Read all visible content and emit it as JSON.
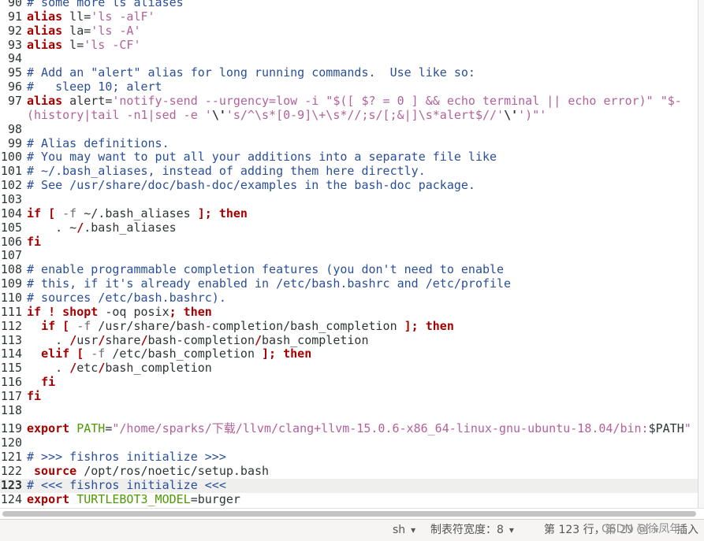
{
  "editor": {
    "lines": [
      {
        "n": "90",
        "segments": [
          {
            "t": "# some more ls aliases",
            "c": "#2a4f9a"
          }
        ]
      },
      {
        "n": "91",
        "segments": [
          {
            "t": "alias",
            "c": "#a40000",
            "b": true
          },
          {
            "t": " ll="
          },
          {
            "t": "'ls -alF'",
            "c": "#b2619a"
          }
        ]
      },
      {
        "n": "92",
        "segments": [
          {
            "t": "alias",
            "c": "#a40000",
            "b": true
          },
          {
            "t": " la="
          },
          {
            "t": "'ls -A'",
            "c": "#b2619a"
          }
        ]
      },
      {
        "n": "93",
        "segments": [
          {
            "t": "alias",
            "c": "#a40000",
            "b": true
          },
          {
            "t": " l="
          },
          {
            "t": "'ls -CF'",
            "c": "#b2619a"
          }
        ]
      },
      {
        "n": "94",
        "segments": []
      },
      {
        "n": "95",
        "segments": [
          {
            "t": "# Add an \"alert\" alias for long running commands.  Use like so:",
            "c": "#2a4f9a"
          }
        ]
      },
      {
        "n": "96",
        "segments": [
          {
            "t": "#   sleep 10; alert",
            "c": "#2a4f9a"
          }
        ]
      },
      {
        "n": "97",
        "segments": [
          {
            "t": "alias",
            "c": "#a40000",
            "b": true
          },
          {
            "t": " alert="
          },
          {
            "t": "'notify-send --urgency=low -i \"$([ $? = 0 ] && echo terminal || echo error)\" \"$-",
            "c": "#b2619a"
          }
        ],
        "continuation": [
          {
            "t": "(history|tail -n1|sed -e '",
            "c": "#b2619a"
          },
          {
            "t": "\\'",
            "c": "#2e3436",
            "b": true
          },
          {
            "t": "'s/^\\s*[0-9]\\+\\s*//;s/[;&|]\\s*alert$//'",
            "c": "#b2619a"
          },
          {
            "t": "\\'",
            "c": "#2e3436",
            "b": true
          },
          {
            "t": "')\"'",
            "c": "#b2619a"
          }
        ]
      },
      {
        "n": "98",
        "segments": []
      },
      {
        "n": "99",
        "segments": [
          {
            "t": "# Alias definitions.",
            "c": "#2a4f9a"
          }
        ]
      },
      {
        "n": "100",
        "segments": [
          {
            "t": "# You may want to put all your additions into a separate file like",
            "c": "#2a4f9a"
          }
        ]
      },
      {
        "n": "101",
        "segments": [
          {
            "t": "# ~/.bash_aliases, instead of adding them here directly.",
            "c": "#2a4f9a"
          }
        ]
      },
      {
        "n": "102",
        "segments": [
          {
            "t": "# See /usr/share/doc/bash-doc/examples in the bash-doc package.",
            "c": "#2a4f9a"
          }
        ]
      },
      {
        "n": "103",
        "segments": []
      },
      {
        "n": "104",
        "segments": [
          {
            "t": "if [",
            "c": "#a40000",
            "b": true
          },
          {
            "t": " "
          },
          {
            "t": "-f",
            "c": "#6d7072"
          },
          {
            "t": " ~/.bash_aliases "
          },
          {
            "t": "]; then",
            "c": "#a40000",
            "b": true
          }
        ]
      },
      {
        "n": "105",
        "segments": [
          {
            "t": "    . ~"
          },
          {
            "t": "/",
            "c": "#a40000",
            "b": true
          },
          {
            "t": ".bash_aliases"
          }
        ]
      },
      {
        "n": "106",
        "segments": [
          {
            "t": "fi",
            "c": "#a40000",
            "b": true
          }
        ]
      },
      {
        "n": "107",
        "segments": []
      },
      {
        "n": "108",
        "segments": [
          {
            "t": "# enable programmable completion features (you don't need to enable",
            "c": "#2a4f9a"
          }
        ]
      },
      {
        "n": "109",
        "segments": [
          {
            "t": "# this, if it's already enabled in /etc/bash.bashrc and /etc/profile",
            "c": "#2a4f9a"
          }
        ]
      },
      {
        "n": "110",
        "segments": [
          {
            "t": "# sources /etc/bash.bashrc).",
            "c": "#2a4f9a"
          }
        ]
      },
      {
        "n": "111",
        "segments": [
          {
            "t": "if ! shopt",
            "c": "#a40000",
            "b": true
          },
          {
            "t": " -oq posix"
          },
          {
            "t": "; then",
            "c": "#a40000",
            "b": true
          }
        ]
      },
      {
        "n": "112",
        "segments": [
          {
            "t": "  "
          },
          {
            "t": "if [",
            "c": "#a40000",
            "b": true
          },
          {
            "t": " "
          },
          {
            "t": "-f",
            "c": "#6d7072"
          },
          {
            "t": " /usr/share/bash-completion/bash_completion "
          },
          {
            "t": "]; then",
            "c": "#a40000",
            "b": true
          }
        ]
      },
      {
        "n": "113",
        "segments": [
          {
            "t": "    . "
          },
          {
            "t": "/",
            "c": "#a40000",
            "b": true
          },
          {
            "t": "usr"
          },
          {
            "t": "/",
            "c": "#a40000",
            "b": true
          },
          {
            "t": "share"
          },
          {
            "t": "/",
            "c": "#a40000",
            "b": true
          },
          {
            "t": "bash-completion"
          },
          {
            "t": "/",
            "c": "#a40000",
            "b": true
          },
          {
            "t": "bash_completion"
          }
        ]
      },
      {
        "n": "114",
        "segments": [
          {
            "t": "  "
          },
          {
            "t": "elif [",
            "c": "#a40000",
            "b": true
          },
          {
            "t": " "
          },
          {
            "t": "-f",
            "c": "#6d7072"
          },
          {
            "t": " /etc/bash_completion "
          },
          {
            "t": "]; then",
            "c": "#a40000",
            "b": true
          }
        ]
      },
      {
        "n": "115",
        "segments": [
          {
            "t": "    . "
          },
          {
            "t": "/",
            "c": "#a40000",
            "b": true
          },
          {
            "t": "etc"
          },
          {
            "t": "/",
            "c": "#a40000",
            "b": true
          },
          {
            "t": "bash_completion"
          }
        ]
      },
      {
        "n": "116",
        "segments": [
          {
            "t": "  "
          },
          {
            "t": "fi",
            "c": "#a40000",
            "b": true
          }
        ]
      },
      {
        "n": "117",
        "segments": [
          {
            "t": "fi",
            "c": "#a40000",
            "b": true
          }
        ]
      },
      {
        "n": "118",
        "segments": []
      },
      {
        "n": "119",
        "segments": [
          {
            "t": "export",
            "c": "#a40000",
            "b": true
          },
          {
            "t": " "
          },
          {
            "t": "PATH",
            "c": "#4e9a06"
          },
          {
            "t": "="
          },
          {
            "t": "\"/home/sparks/下载/llvm/clang+llvm-15.0.6-x86_64-linux-gnu-ubuntu-18.04/bin:",
            "c": "#b2619a"
          },
          {
            "t": "$PATH",
            "c": "#2e3436"
          },
          {
            "t": "\"",
            "c": "#b2619a"
          }
        ]
      },
      {
        "n": "120",
        "segments": []
      },
      {
        "n": "121",
        "segments": [
          {
            "t": "# >>> fishros initialize >>>",
            "c": "#2a4f9a"
          }
        ]
      },
      {
        "n": "122",
        "segments": [
          {
            "t": " "
          },
          {
            "t": "source",
            "c": "#a40000",
            "b": true
          },
          {
            "t": " /opt/ros/noetic/setup.bash"
          }
        ]
      },
      {
        "n": "123",
        "current": true,
        "segments": [
          {
            "t": "# <<< fishros initialize <<<",
            "c": "#2a4f9a"
          }
        ]
      },
      {
        "n": "124",
        "segments": [
          {
            "t": "export",
            "c": "#a40000",
            "b": true
          },
          {
            "t": " "
          },
          {
            "t": "TURTLEBOT3_MODEL",
            "c": "#4e9a06"
          },
          {
            "t": "=burger"
          }
        ]
      }
    ]
  },
  "statusbar": {
    "language": "sh",
    "tab_width": "制表符宽度：8",
    "position": "第 123 行，第 29 列",
    "mode": "插入",
    "dropdown_icon": "chevron-down-icon"
  },
  "watermark": "CSDN @徐凤年"
}
